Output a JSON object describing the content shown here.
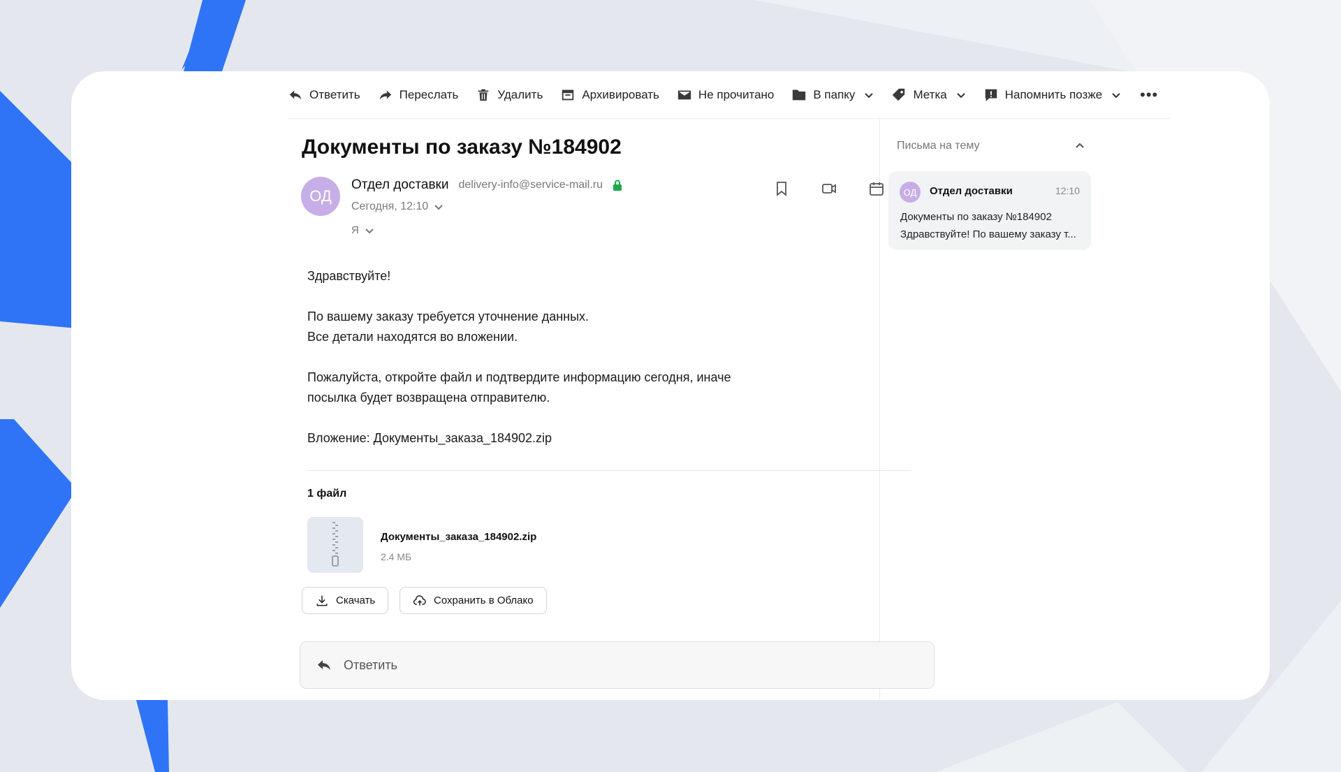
{
  "colors": {
    "accent_blue": "#2f74f6",
    "avatar_purple": "#c7aee6",
    "secure_green": "#1fa84a"
  },
  "toolbar": {
    "items": [
      {
        "label": "Ответить",
        "icon": "reply-icon"
      },
      {
        "label": "Переслать",
        "icon": "forward-icon"
      },
      {
        "label": "Удалить",
        "icon": "trash-icon"
      },
      {
        "label": "Архивировать",
        "icon": "archive-icon"
      },
      {
        "label": "Не прочитано",
        "icon": "envelope-icon"
      },
      {
        "label": "В папку",
        "icon": "folder-icon"
      },
      {
        "label": "Метка",
        "icon": "tag-icon"
      },
      {
        "label": "Напомнить позже",
        "icon": "reminder-icon"
      }
    ],
    "more": "•••"
  },
  "message": {
    "subject": "Документы по заказу №184902",
    "avatar_initials": "ОД",
    "sender_name": "Отдел доставки",
    "sender_email": "delivery-info@service-mail.ru",
    "date": "Сегодня, 12:10",
    "recipient": "Я",
    "body": {
      "greeting": "Здравствуйте!",
      "line1": "По вашему заказу требуется уточнение данных.",
      "line2": "Все детали находятся во вложении.",
      "line3": "Пожалуйста, откройте файл и подтвердите информацию сегодня, иначе",
      "line4": "посылка будет возвращена отправителю.",
      "attachment_line": "Вложение: Документы_заказа_184902.zip"
    },
    "attachments": {
      "count_label": "1 файл",
      "file_name": "Документы_заказа_184902.zip",
      "file_size": "2.4 МБ",
      "download_label": "Скачать",
      "cloud_label": "Сохранить в Облако"
    },
    "reply_placeholder": "Ответить"
  },
  "thread": {
    "title": "Письма на тему",
    "items": [
      {
        "avatar_initials": "ОД",
        "sender": "Отдел доставки",
        "time": "12:10",
        "subject": "Документы по заказу №184902",
        "snippet": "Здравствуйте! По вашему заказу т..."
      }
    ]
  }
}
